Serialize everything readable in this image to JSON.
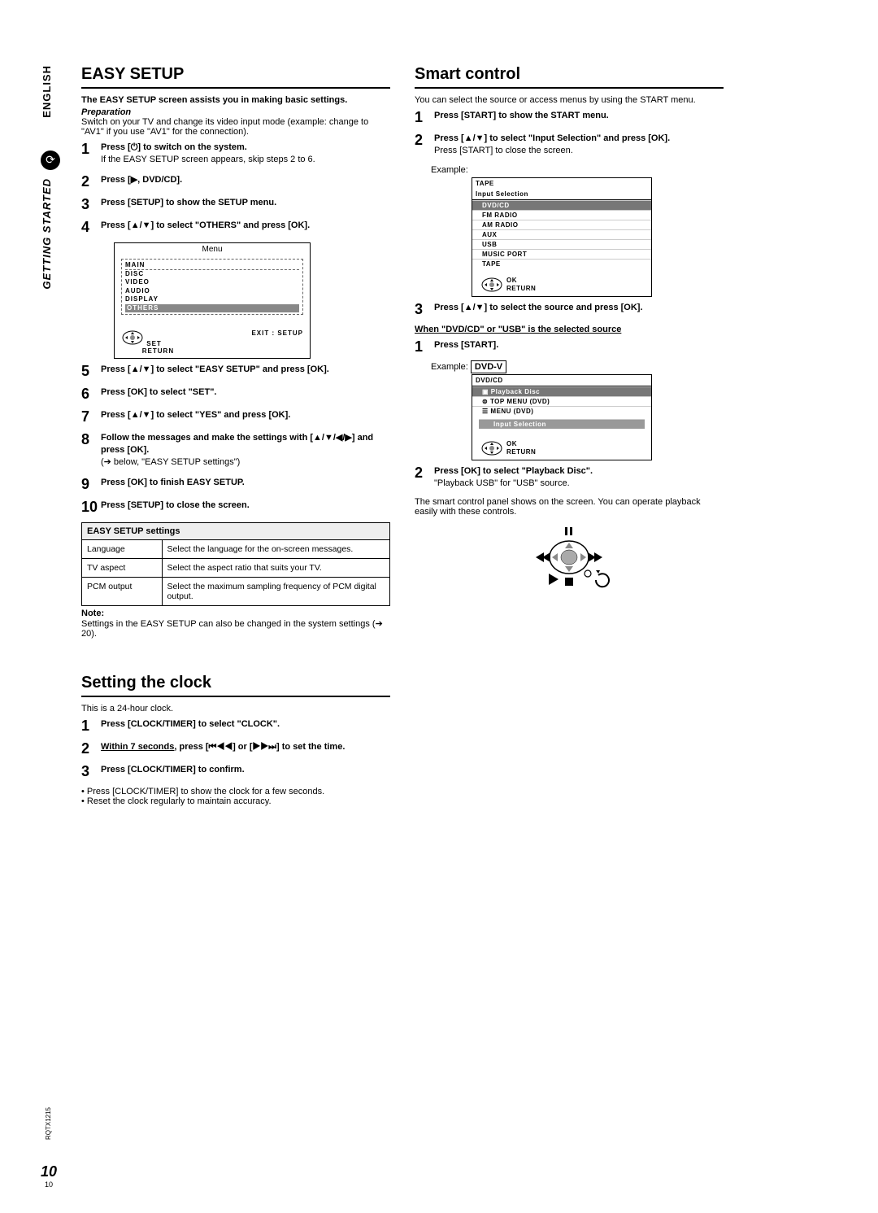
{
  "sidebar": {
    "lang": "ENGLISH",
    "section": "GETTING STARTED"
  },
  "left": {
    "h1": "EASY SETUP",
    "intro_bold": "The EASY SETUP screen assists you in making basic settings.",
    "prep_h": "Preparation",
    "prep_body": "Switch on your TV and change its video input mode (example: change to \"AV1\" if you use \"AV1\" for the connection).",
    "steps": [
      {
        "n": "1",
        "b": "Press [⏻] to switch on the system.",
        "sub": "If the EASY SETUP screen appears, skip steps 2 to 6."
      },
      {
        "n": "2",
        "b": "Press [▶, DVD/CD]."
      },
      {
        "n": "3",
        "b": "Press [SETUP] to show the SETUP menu."
      },
      {
        "n": "4",
        "b": "Press [▲/▼] to select \"OTHERS\" and press [OK]."
      },
      {
        "n": "5",
        "b": "Press [▲/▼] to select \"EASY SETUP\" and press [OK]."
      },
      {
        "n": "6",
        "b": "Press [OK] to select \"SET\"."
      },
      {
        "n": "7",
        "b": "Press [▲/▼] to select \"YES\" and press [OK]."
      },
      {
        "n": "8",
        "b": "Follow the messages and make the settings with [▲/▼/◀/▶] and press [OK].",
        "sub": "(➔ below, \"EASY SETUP settings\")"
      },
      {
        "n": "9",
        "b": "Press [OK] to finish EASY SETUP."
      },
      {
        "n": "10",
        "b": "Press [SETUP] to close the screen."
      }
    ],
    "menu": {
      "title": "Menu",
      "main": "MAIN",
      "items": [
        "DISC",
        "VIDEO",
        "AUDIO",
        "DISPLAY",
        "OTHERS"
      ],
      "set": "SET",
      "return": "RETURN",
      "exit": "EXIT : SETUP"
    },
    "settings_h": "EASY SETUP settings",
    "settings": [
      {
        "k": "Language",
        "v": "Select the language for the on-screen messages."
      },
      {
        "k": "TV aspect",
        "v": "Select the aspect ratio that suits your TV."
      },
      {
        "k": "PCM output",
        "v": "Select the maximum sampling frequency of PCM digital output."
      }
    ],
    "note_h": "Note:",
    "note": "Settings in the EASY SETUP can also be changed in the system settings (➔ 20).",
    "h2": "Setting the clock",
    "clock_intro": "This is a 24-hour clock.",
    "clock_steps": [
      {
        "n": "1",
        "b": "Press [CLOCK/TIMER] to select \"CLOCK\"."
      },
      {
        "n": "2",
        "pre_u": "Within 7 seconds,",
        "b": " press [⏮◀◀] or [▶▶⏭] to set the time."
      },
      {
        "n": "3",
        "b": "Press [CLOCK/TIMER] to confirm."
      }
    ],
    "clock_notes": [
      "Press [CLOCK/TIMER] to show the clock for a few seconds.",
      "Reset the clock regularly to maintain accuracy."
    ]
  },
  "right": {
    "h1": "Smart control",
    "intro": "You can select the source or access menus by using the START menu.",
    "steps_a": [
      {
        "n": "1",
        "b": "Press [START] to show the START menu."
      },
      {
        "n": "2",
        "b": "Press [▲/▼] to select \"Input Selection\" and press [OK].",
        "sub": "Press [START] to close the screen."
      }
    ],
    "example": "Example:",
    "panel_input": {
      "head1": "TAPE",
      "head2": "Input Selection",
      "items": [
        "DVD/CD",
        "FM RADIO",
        "AM RADIO",
        "AUX",
        "USB",
        "MUSIC PORT",
        "TAPE"
      ],
      "ok": "OK",
      "return": "RETURN"
    },
    "step3": {
      "n": "3",
      "b": "Press [▲/▼] to select the source and press [OK]."
    },
    "when_head": "When \"DVD/CD\" or \"USB\" is the selected source",
    "step_b1": {
      "n": "1",
      "b": "Press [START]."
    },
    "example2_pre": "Example:",
    "example2_box": "DVD-V",
    "panel_dvdcd": {
      "head": "DVD/CD",
      "items": [
        "Playback Disc",
        "TOP MENU (DVD)",
        "MENU (DVD)"
      ],
      "sub": "Input Selection",
      "ok": "OK",
      "return": "RETURN"
    },
    "step_b2": {
      "n": "2",
      "b": "Press [OK] to select \"Playback Disc\".",
      "sub": "\"Playback USB\" for \"USB\" source."
    },
    "outro": "The smart control panel shows on the screen. You can operate playback easily with these controls."
  },
  "footer": {
    "doc_code": "RQTX1215",
    "page_big": "10",
    "page_small": "10"
  }
}
